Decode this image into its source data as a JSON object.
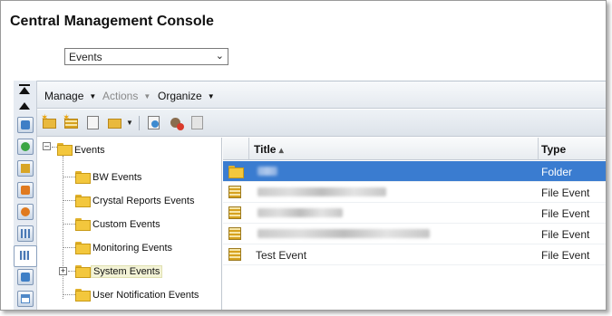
{
  "app": {
    "title": "Central Management Console"
  },
  "nav_select": {
    "value": "Events"
  },
  "menubar": {
    "items": [
      "Manage",
      "Actions",
      "Organize"
    ]
  },
  "tree": {
    "root": "Events",
    "children": [
      "BW Events",
      "Crystal Reports Events",
      "Custom Events",
      "Monitoring Events",
      "System Events",
      "User Notification Events"
    ],
    "selected": "System Events"
  },
  "table": {
    "columns": {
      "title": "Title",
      "type": "Type"
    },
    "sort_indicator": "▴",
    "rows": [
      {
        "title": "",
        "type": "Folder",
        "icon": "folder-icon",
        "selected": true,
        "redacted": true
      },
      {
        "title": "",
        "type": "File Event",
        "icon": "file-event-icon",
        "selected": false,
        "redacted": true
      },
      {
        "title": "",
        "type": "File Event",
        "icon": "file-event-icon",
        "selected": false,
        "redacted": true
      },
      {
        "title": "",
        "type": "File Event",
        "icon": "file-event-icon",
        "selected": false,
        "redacted": true
      },
      {
        "title": "Test Event",
        "type": "File Event",
        "icon": "file-event-icon",
        "selected": false,
        "redacted": false
      }
    ]
  },
  "colors": {
    "selection": "#3a7cd0",
    "folder": "#f3c73d"
  }
}
